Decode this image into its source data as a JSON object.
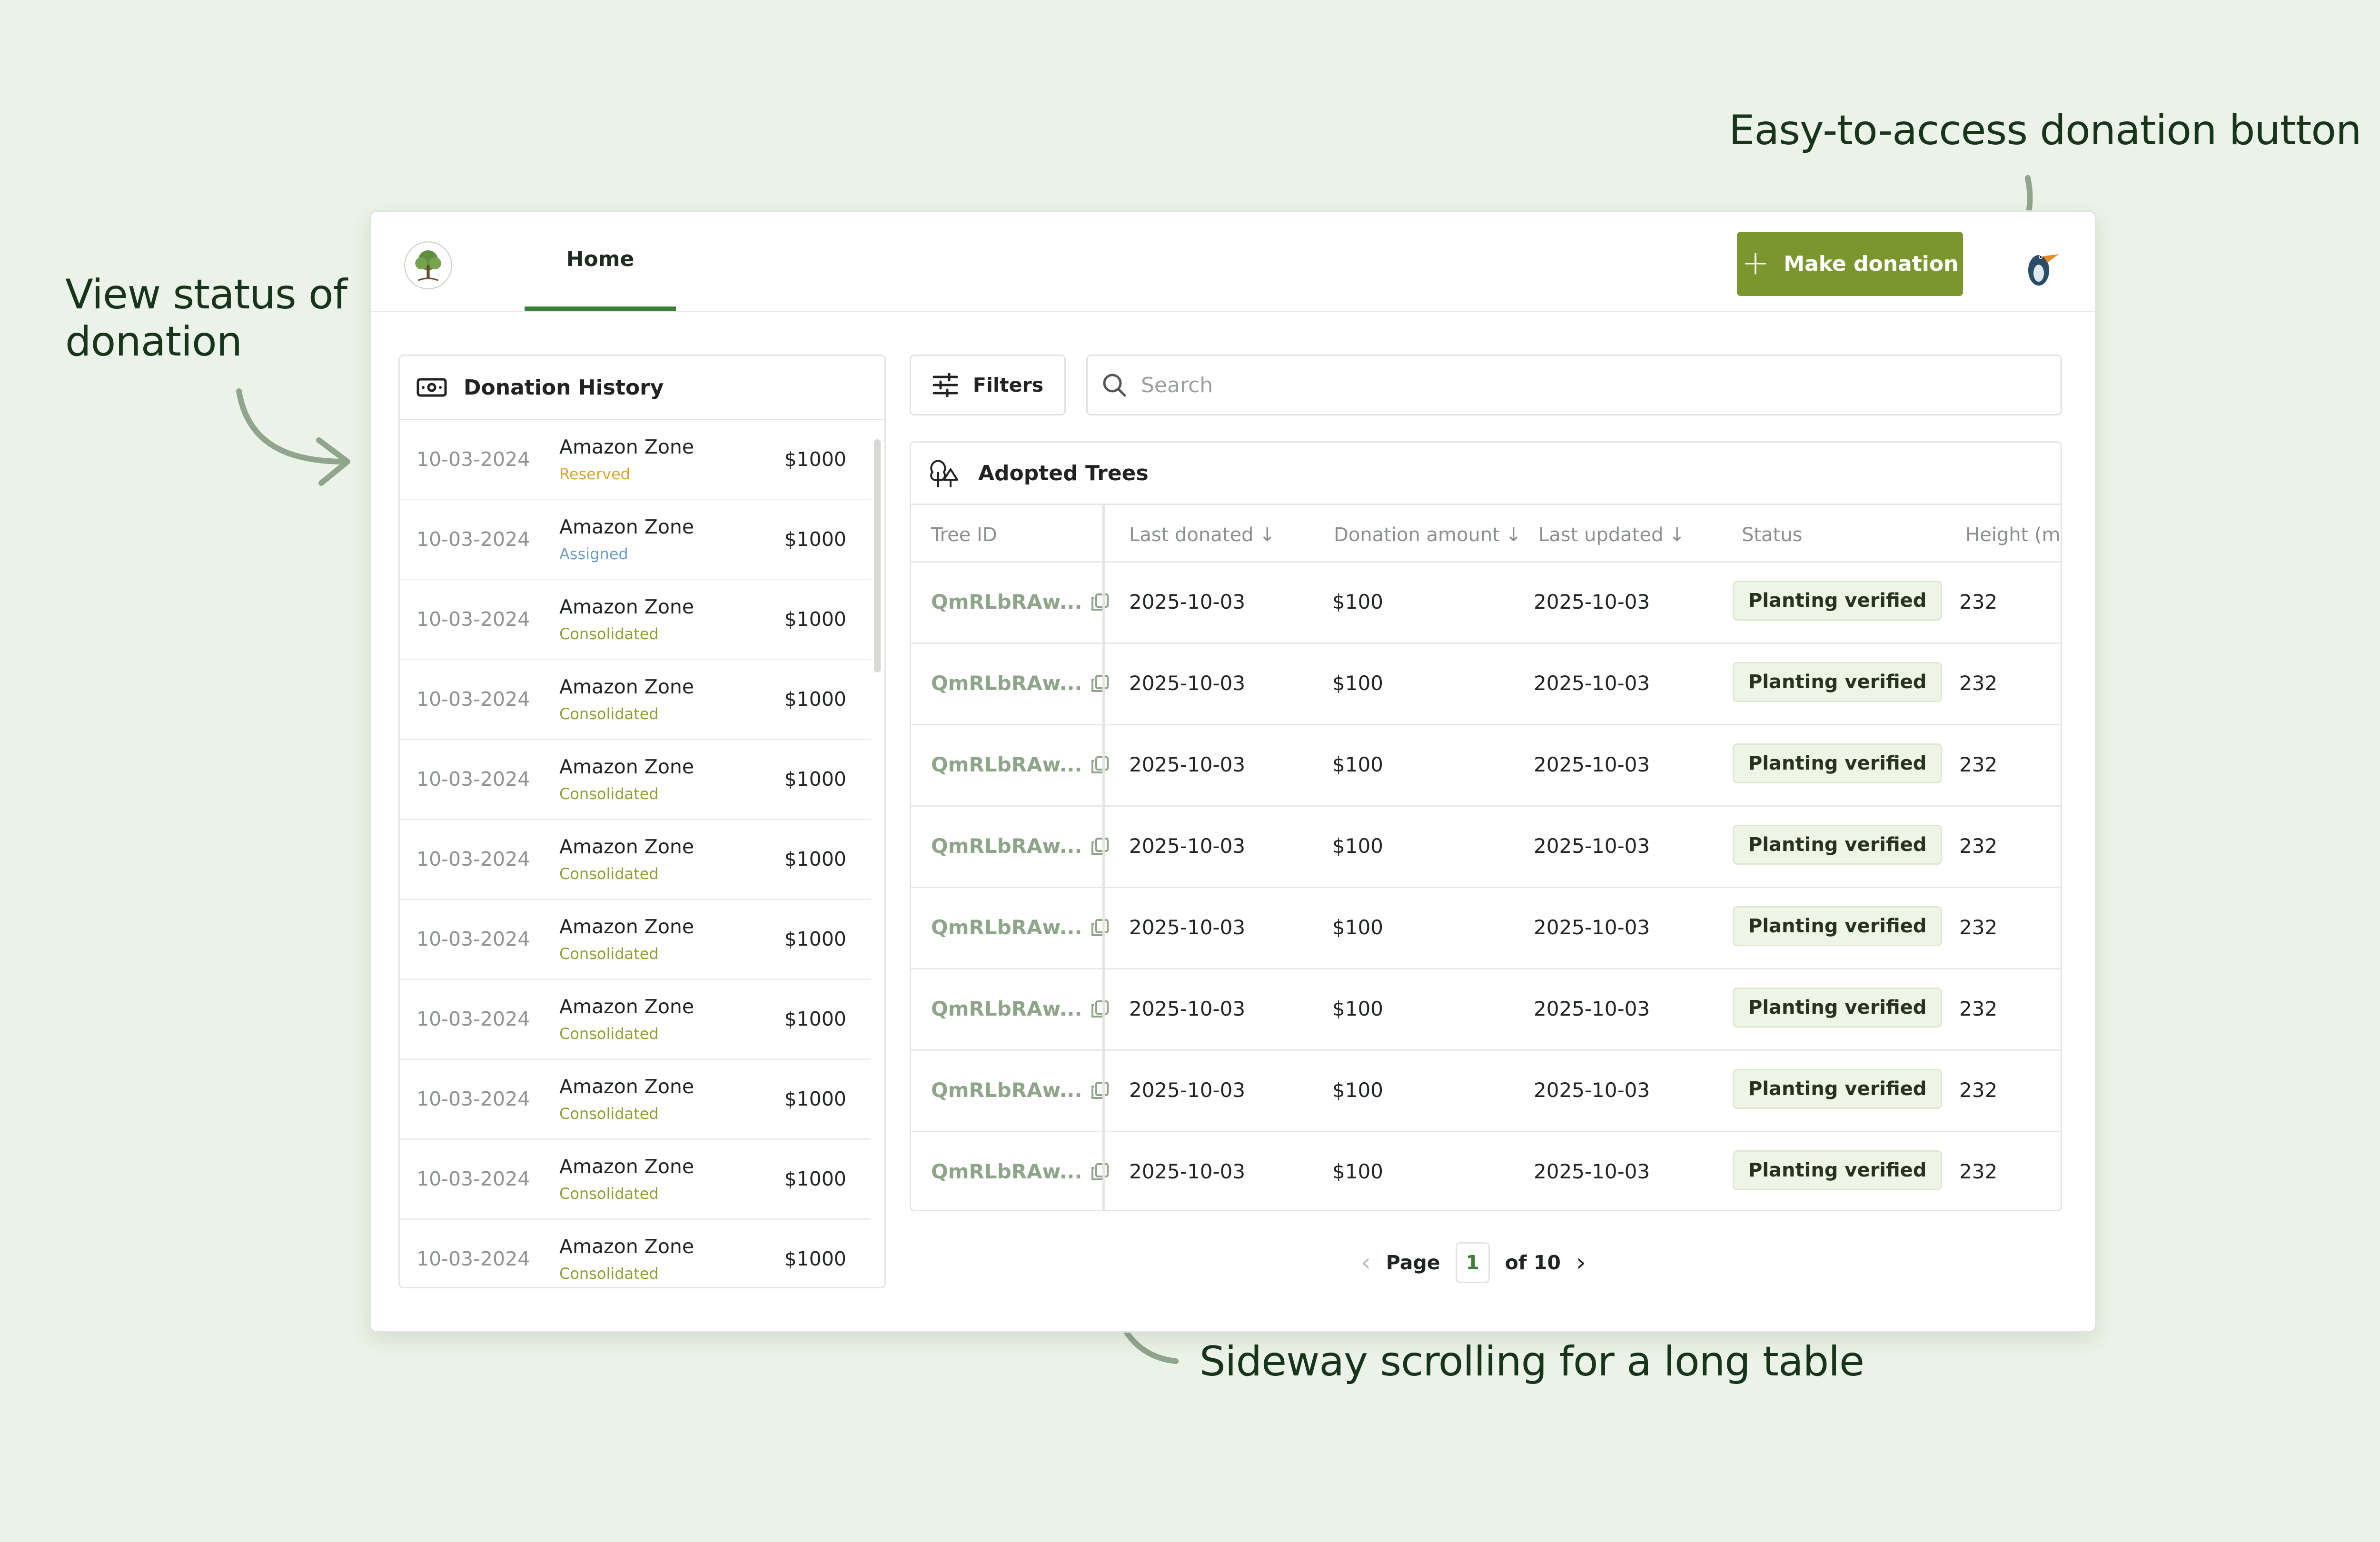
{
  "annotations": {
    "left": "View status of donation",
    "top": "Easy-to-access donation button",
    "bottom": "Sideway scrolling for a long table"
  },
  "header": {
    "tab_home": "Home",
    "donate_label": "Make donation",
    "logo_icon": "tree-logo-icon",
    "avatar_icon": "toucan-avatar-icon"
  },
  "colors": {
    "background": "#ebf2e7",
    "accent": "#7a962c",
    "tab_underline": "#3f7d3a",
    "status_reserved": "#d9a634",
    "status_assigned": "#6e9ccc",
    "status_consolidated": "#8aa12f"
  },
  "donation_history": {
    "title": "Donation History",
    "items": [
      {
        "date": "10-03-2024",
        "zone": "Amazon Zone",
        "status": "Reserved",
        "amount": "$1000"
      },
      {
        "date": "10-03-2024",
        "zone": "Amazon Zone",
        "status": "Assigned",
        "amount": "$1000"
      },
      {
        "date": "10-03-2024",
        "zone": "Amazon Zone",
        "status": "Consolidated",
        "amount": "$1000"
      },
      {
        "date": "10-03-2024",
        "zone": "Amazon Zone",
        "status": "Consolidated",
        "amount": "$1000"
      },
      {
        "date": "10-03-2024",
        "zone": "Amazon Zone",
        "status": "Consolidated",
        "amount": "$1000"
      },
      {
        "date": "10-03-2024",
        "zone": "Amazon Zone",
        "status": "Consolidated",
        "amount": "$1000"
      },
      {
        "date": "10-03-2024",
        "zone": "Amazon Zone",
        "status": "Consolidated",
        "amount": "$1000"
      },
      {
        "date": "10-03-2024",
        "zone": "Amazon Zone",
        "status": "Consolidated",
        "amount": "$1000"
      },
      {
        "date": "10-03-2024",
        "zone": "Amazon Zone",
        "status": "Consolidated",
        "amount": "$1000"
      },
      {
        "date": "10-03-2024",
        "zone": "Amazon Zone",
        "status": "Consolidated",
        "amount": "$1000"
      },
      {
        "date": "10-03-2024",
        "zone": "Amazon Zone",
        "status": "Consolidated",
        "amount": "$1000"
      }
    ]
  },
  "toolbar": {
    "filters_label": "Filters",
    "search_placeholder": "Search"
  },
  "adopted_trees": {
    "title": "Adopted Trees",
    "columns": [
      "Tree ID",
      "Last donated",
      "Donation amount",
      "Last updated",
      "Status",
      "Height (m)"
    ],
    "rows": [
      {
        "id": "QmRLbRAw...",
        "last_donated": "2025-10-03",
        "amount": "$100",
        "last_updated": "2025-10-03",
        "status": "Planting verified",
        "height": "232"
      },
      {
        "id": "QmRLbRAw...",
        "last_donated": "2025-10-03",
        "amount": "$100",
        "last_updated": "2025-10-03",
        "status": "Planting verified",
        "height": "232"
      },
      {
        "id": "QmRLbRAw...",
        "last_donated": "2025-10-03",
        "amount": "$100",
        "last_updated": "2025-10-03",
        "status": "Planting verified",
        "height": "232"
      },
      {
        "id": "QmRLbRAw...",
        "last_donated": "2025-10-03",
        "amount": "$100",
        "last_updated": "2025-10-03",
        "status": "Planting verified",
        "height": "232"
      },
      {
        "id": "QmRLbRAw...",
        "last_donated": "2025-10-03",
        "amount": "$100",
        "last_updated": "2025-10-03",
        "status": "Planting verified",
        "height": "232"
      },
      {
        "id": "QmRLbRAw...",
        "last_donated": "2025-10-03",
        "amount": "$100",
        "last_updated": "2025-10-03",
        "status": "Planting verified",
        "height": "232"
      },
      {
        "id": "QmRLbRAw...",
        "last_donated": "2025-10-03",
        "amount": "$100",
        "last_updated": "2025-10-03",
        "status": "Planting verified",
        "height": "232"
      },
      {
        "id": "QmRLbRAw...",
        "last_donated": "2025-10-03",
        "amount": "$100",
        "last_updated": "2025-10-03",
        "status": "Planting verified",
        "height": "232"
      }
    ]
  },
  "pagination": {
    "page_label": "Page",
    "current_page": "1",
    "total_label": "of 10"
  }
}
